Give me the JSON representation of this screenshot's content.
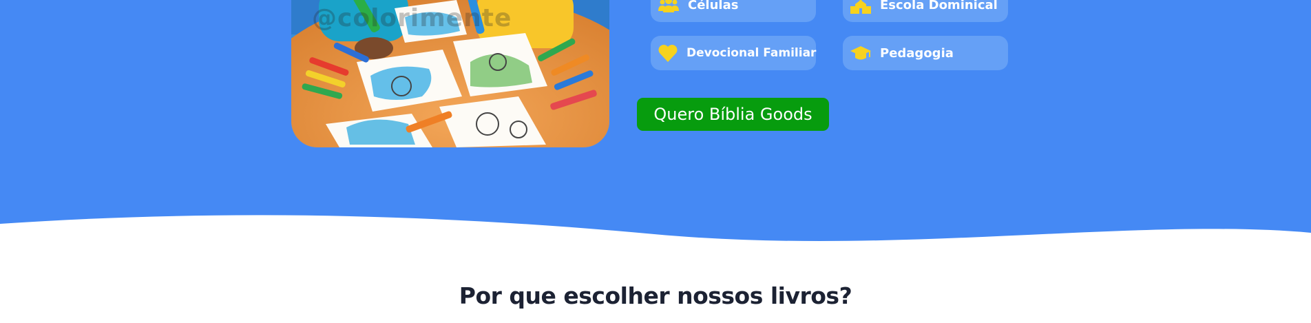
{
  "hero": {
    "background_color": "#4589f4",
    "image": {
      "watermark": "@colorimente",
      "description_icon": "children-coloring-illustration"
    },
    "audiences": [
      {
        "label": "Células",
        "icon": "people-group-icon"
      },
      {
        "label": "Escola Dominical",
        "icon": "church-icon"
      },
      {
        "label": "Devocional Familiar",
        "icon": "heart-icon"
      },
      {
        "label": "Pedagogia",
        "icon": "graduation-cap-icon"
      }
    ],
    "cta_label": "Quero Bíblia Goods",
    "cta_color": "#079c0e",
    "chip_color": "#65a0f6",
    "icon_color": "#f7d21e"
  },
  "features": {
    "title": "Por que escolher nossos livros?"
  }
}
